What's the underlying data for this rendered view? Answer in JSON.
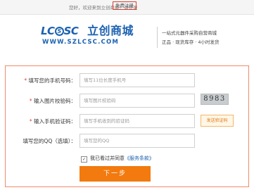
{
  "topbar": {
    "greeting": "您好，欢迎来到立创商城！",
    "login": "请登录",
    "register": "免费注册"
  },
  "logo": {
    "lc_prefix": "LC",
    "lc_at": "S",
    "lc_suffix": "SC",
    "name_cn": "立创商城",
    "url": "WWW.SZLCSC.COM",
    "slogan_line1": "一站式元器件采购自营商城",
    "slogan_line2": "正品 · 现货库存 · 4小时发货"
  },
  "form": {
    "phone_label": "填写您的手机号码：",
    "phone_placeholder": "填写11位长度手机号",
    "captcha_label": "输入图片校验码：",
    "captcha_placeholder": "填写图片校验码",
    "captcha_code": "8983",
    "sms_label": "输入手机验证码：",
    "sms_placeholder": "填写手机收到的验证码",
    "sms_button": "发送验证码",
    "qq_label": "填写您的QQ（选填）：",
    "qq_placeholder": "填写您的QQ",
    "agree_text": "我已看过并同意",
    "terms_link": "《服务条款》",
    "next_button": "下一步"
  },
  "colors": {
    "brand_blue": "#1a61b0",
    "accent_orange": "#f27a0e",
    "required_red": "#e03d2c"
  }
}
